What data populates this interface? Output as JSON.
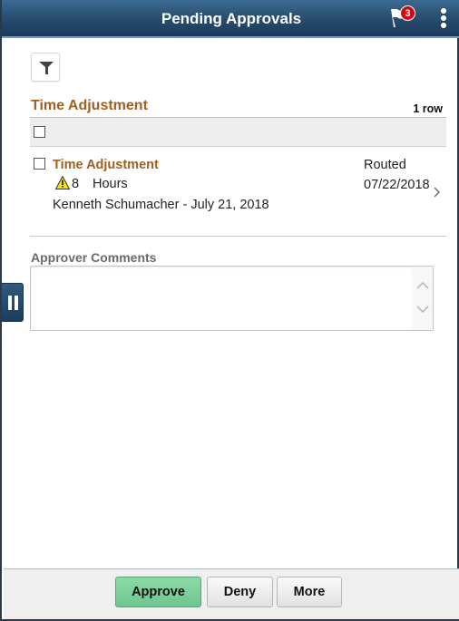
{
  "header": {
    "title": "Pending Approvals",
    "notification_count": "3",
    "icons": {
      "notifications": "flag-icon",
      "actions": "kebab-menu-icon"
    }
  },
  "toolbar": {
    "filter_icon": "filter-icon"
  },
  "section": {
    "title": "Time Adjustment",
    "row_count": "1 row"
  },
  "rows": [
    {
      "title": "Time Adjustment",
      "warning_icon": "warning-icon",
      "quantity": "8",
      "unit": "Hours",
      "person_date": "Kenneth Schumacher - July 21, 2018",
      "status": "Routed",
      "date": "07/22/2018"
    }
  ],
  "comments": {
    "label": "Approver Comments",
    "value": ""
  },
  "footer": {
    "approve_label": "Approve",
    "deny_label": "Deny",
    "more_label": "More"
  },
  "colors": {
    "header": "#2a5072",
    "accent_title": "#a15e1c",
    "approve": "#7dcf9c",
    "badge": "#d4070f"
  }
}
